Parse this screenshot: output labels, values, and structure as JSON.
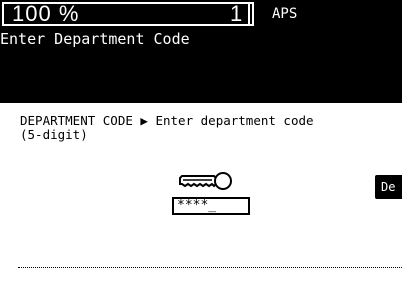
{
  "status": {
    "zoom": "100 %",
    "copies": "1",
    "paper": "APS"
  },
  "prompt": "Enter Department Code",
  "path": {
    "section": "DEPARTMENT CODE",
    "arrow": "▶",
    "instruction_line1": "Enter department code",
    "instruction_line2": "(5-digit)"
  },
  "code_entry": {
    "masked_value": "****_"
  },
  "side_button": {
    "label": "De"
  },
  "icons": {
    "key": "key-icon",
    "arrow": "arrow-right-icon"
  }
}
